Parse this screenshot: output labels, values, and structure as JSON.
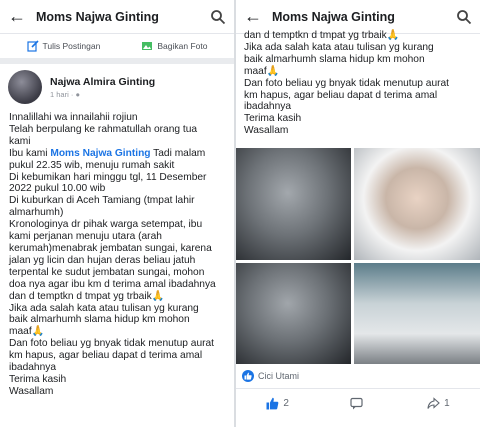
{
  "left": {
    "header": {
      "title": "Moms Najwa Ginting"
    },
    "actions": {
      "write_post": "Tulis Postingan",
      "share_photo": "Bagikan Foto"
    },
    "post": {
      "author": "Najwa Almira Ginting",
      "time": "1 hari",
      "lines_a": [
        "Innalillahi wa innailahii rojiun",
        "Telah berpulang ke rahmatullah orang tua",
        "kami"
      ],
      "line_mention_prefix": "Ibu kami ",
      "mention": "Moms Najwa Ginting",
      "line_mention_suffix": " Tadi malam",
      "lines_b": [
        "pukul 22.35 wib, menuju rumah sakit",
        "Di kebumikan hari minggu tgl, 11 Desember",
        "2022 pukul 10.00 wib",
        "Di kuburkan di Aceh Tamiang (tmpat lahir",
        "almarhumh)",
        "Kronologinya dr pihak warga setempat, ibu",
        "kami perjanan menuju utara (arah",
        "kerumah)menabrak jembatan sungai, karena",
        "jalan yg licin dan hujan deras beliau jatuh",
        "terpental ke sudut jembatan sungai, mohon",
        "doa nya agar ibu km d terima amal ibadahnya",
        "dan d temptkn d tmpat yg trbaik🙏",
        "Jika ada salah kata atau tulisan yg kurang",
        "baik almarhumh slama hidup km mohon",
        "maaf🙏",
        "Dan foto beliau yg bnyak tidak menutup aurat",
        "km hapus, agar beliau dapat d terima amal",
        "ibadahnya",
        "Terima kasih",
        "Wasallam"
      ]
    }
  },
  "right": {
    "header": {
      "title": "Moms Najwa Ginting"
    },
    "lines": [
      "dan d temptkn d tmpat yg trbaik🙏",
      "Jika ada salah kata atau tulisan yg kurang",
      "baik almarhumh slama hidup km mohon",
      "maaf🙏",
      "Dan foto beliau yg bnyak tidak menutup aurat",
      "km hapus, agar beliau dapat d terima amal",
      "ibadahnya",
      "Terima kasih",
      "Wasallam"
    ],
    "reactions": {
      "name": "Cici Utami"
    },
    "footer": {
      "likes": "2",
      "shares": "1"
    }
  },
  "colors": {
    "accent": "#1b74e4",
    "separator": "#e9ebee"
  }
}
